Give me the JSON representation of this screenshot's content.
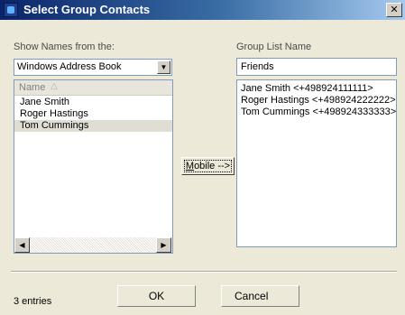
{
  "window": {
    "title": "Select Group Contacts",
    "close_label": "✕"
  },
  "left": {
    "show_label": "Show Names from the:",
    "source": "Windows Address Book",
    "column_header": "Name",
    "sort_indicator": "△",
    "contacts": [
      "Jane Smith",
      "Roger Hastings",
      "Tom Cummings"
    ],
    "selected_contact": "Tom Cummings"
  },
  "transfer_button": {
    "label": "Mobile -->"
  },
  "right": {
    "group_label": "Group List Name",
    "group_name": "Friends",
    "members": [
      "Jane Smith <+498924111111>",
      "Roger Hastings <+498924222222>",
      "Tom Cummings <+498924333333>"
    ]
  },
  "footer": {
    "status": "3 entries",
    "ok_label": "OK",
    "cancel_label": "Cancel"
  },
  "icons": {
    "dropdown": "chevron-down-icon",
    "scroll_left": "arrow-left-icon",
    "scroll_right": "arrow-right-icon"
  }
}
